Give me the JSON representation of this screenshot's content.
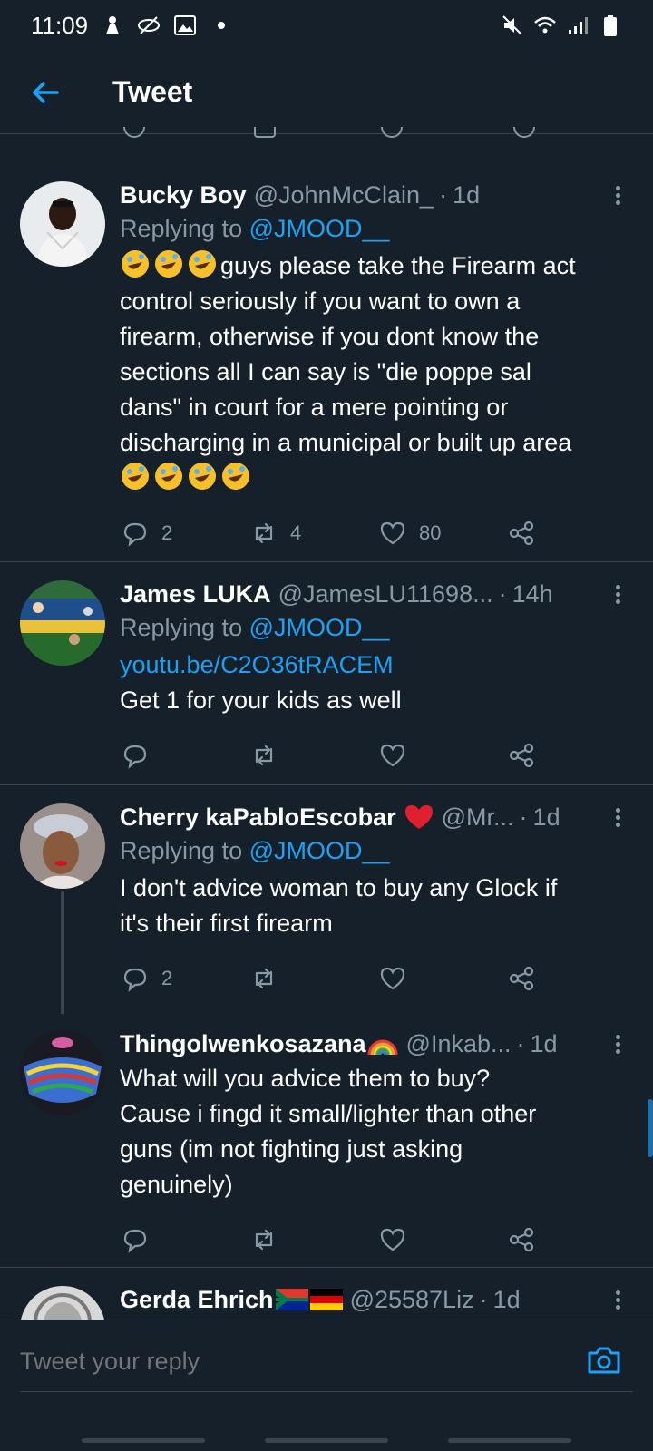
{
  "status_bar": {
    "time": "11:09"
  },
  "header": {
    "title": "Tweet",
    "back_icon": "arrow-left-icon"
  },
  "colors": {
    "background": "#15202b",
    "accent": "#1da1f2",
    "muted": "#8899a6",
    "divider": "#38444d"
  },
  "tweets": [
    {
      "name": "Bucky Boy",
      "handle": "@JohnMcClain_",
      "dot": "·",
      "time": "1d",
      "replying_label": "Replying to",
      "replying_to": "@JMOOD__",
      "text_lines": [
        "guys please take the Firearm act",
        "control seriously if you want to own a",
        "firearm, otherwise if you dont know the",
        "sections all I can say is \"die poppe sal",
        "dans\" in court for a mere pointing or",
        "discharging in a municipal or built up area"
      ],
      "replies": "2",
      "retweets": "4",
      "likes": "80"
    },
    {
      "name": "James LUKA",
      "handle": "@JamesLU11698...",
      "dot": "·",
      "time": "14h",
      "replying_label": "Replying to",
      "replying_to": "@JMOOD__",
      "link": "youtu.be/C2O36tRACEM",
      "text": "Get 1 for your kids as well",
      "replies": "",
      "retweets": "",
      "likes": ""
    },
    {
      "name": "Cherry kaPabloEscobar",
      "handle": "@Mr...",
      "dot": "·",
      "time": "1d",
      "replying_label": "Replying to",
      "replying_to": "@JMOOD__",
      "text_lines": [
        "I don't advice woman to buy any Glock if",
        "it's their first firearm"
      ],
      "replies": "2",
      "retweets": "",
      "likes": ""
    },
    {
      "name": "Thingolwenkosazana",
      "handle": "@Inkab...",
      "dot": "·",
      "time": "1d",
      "text_lines": [
        "What will you advice them to buy?",
        "Cause i fingd it small/lighter than other",
        "guns (im not fighting just asking",
        "genuinely)"
      ],
      "replies": "",
      "retweets": "",
      "likes": ""
    },
    {
      "name": "Gerda Ehrich",
      "handle": "@25587Liz",
      "dot": "·",
      "time": "1d"
    }
  ],
  "reply_bar": {
    "placeholder": "Tweet your reply",
    "camera_icon": "camera-icon"
  }
}
